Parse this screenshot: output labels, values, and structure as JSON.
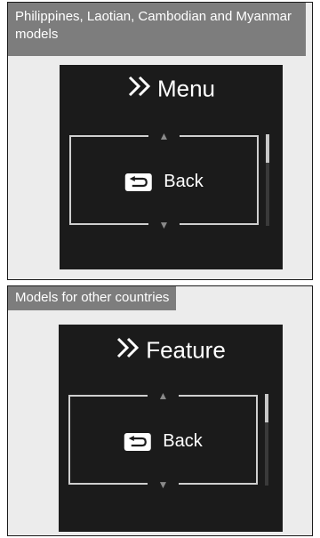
{
  "panels": [
    {
      "label": "Philippines, Laotian, Cambodian and Myanmar models",
      "screen": {
        "title": "Menu",
        "item": {
          "icon": "back-arrow-icon",
          "label": "Back"
        },
        "scroll_position": 0.0
      }
    },
    {
      "label": "Models for other countries",
      "screen": {
        "title": "Feature",
        "item": {
          "icon": "back-arrow-icon",
          "label": "Back"
        },
        "scroll_position": 0.0
      }
    }
  ],
  "colors": {
    "screen_background": "#1b1b1b",
    "label_background": "#7d7d7d",
    "panel_background": "#ececec"
  }
}
